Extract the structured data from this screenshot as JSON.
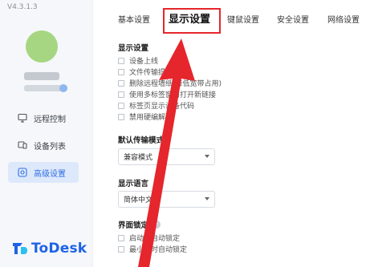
{
  "app": {
    "version": "V4.3.1.3",
    "logo_text": "ToDesk"
  },
  "sidebar": {
    "items": [
      {
        "label": "远程控制",
        "icon": "monitor-icon"
      },
      {
        "label": "设备列表",
        "icon": "devices-icon"
      },
      {
        "label": "高级设置",
        "icon": "settings-icon",
        "active": true
      }
    ]
  },
  "tabs": [
    {
      "label": "基本设置"
    },
    {
      "label": "显示设置",
      "active": true
    },
    {
      "label": "键鼠设置"
    },
    {
      "label": "安全设置"
    },
    {
      "label": "网络设置"
    }
  ],
  "display_section": {
    "title": "显示设置",
    "options": [
      "设备上线",
      "文件传输提醒",
      "删除远程墙纸(降低宽带占用)",
      "使用多标签窗口打开新链接",
      "标签页显示设备代码",
      "禁用硬编解码"
    ]
  },
  "transfer": {
    "title": "默认传输模式",
    "value": "兼容模式"
  },
  "language": {
    "title": "显示语言",
    "value": "简体中文"
  },
  "lock": {
    "title": "界面锁定",
    "help": "?",
    "options": [
      "启动时自动锁定",
      "最小化时自动锁定"
    ]
  },
  "colors": {
    "accent": "#2f6fe4",
    "highlight": "#e5262c",
    "avatar": "#a6d681"
  }
}
